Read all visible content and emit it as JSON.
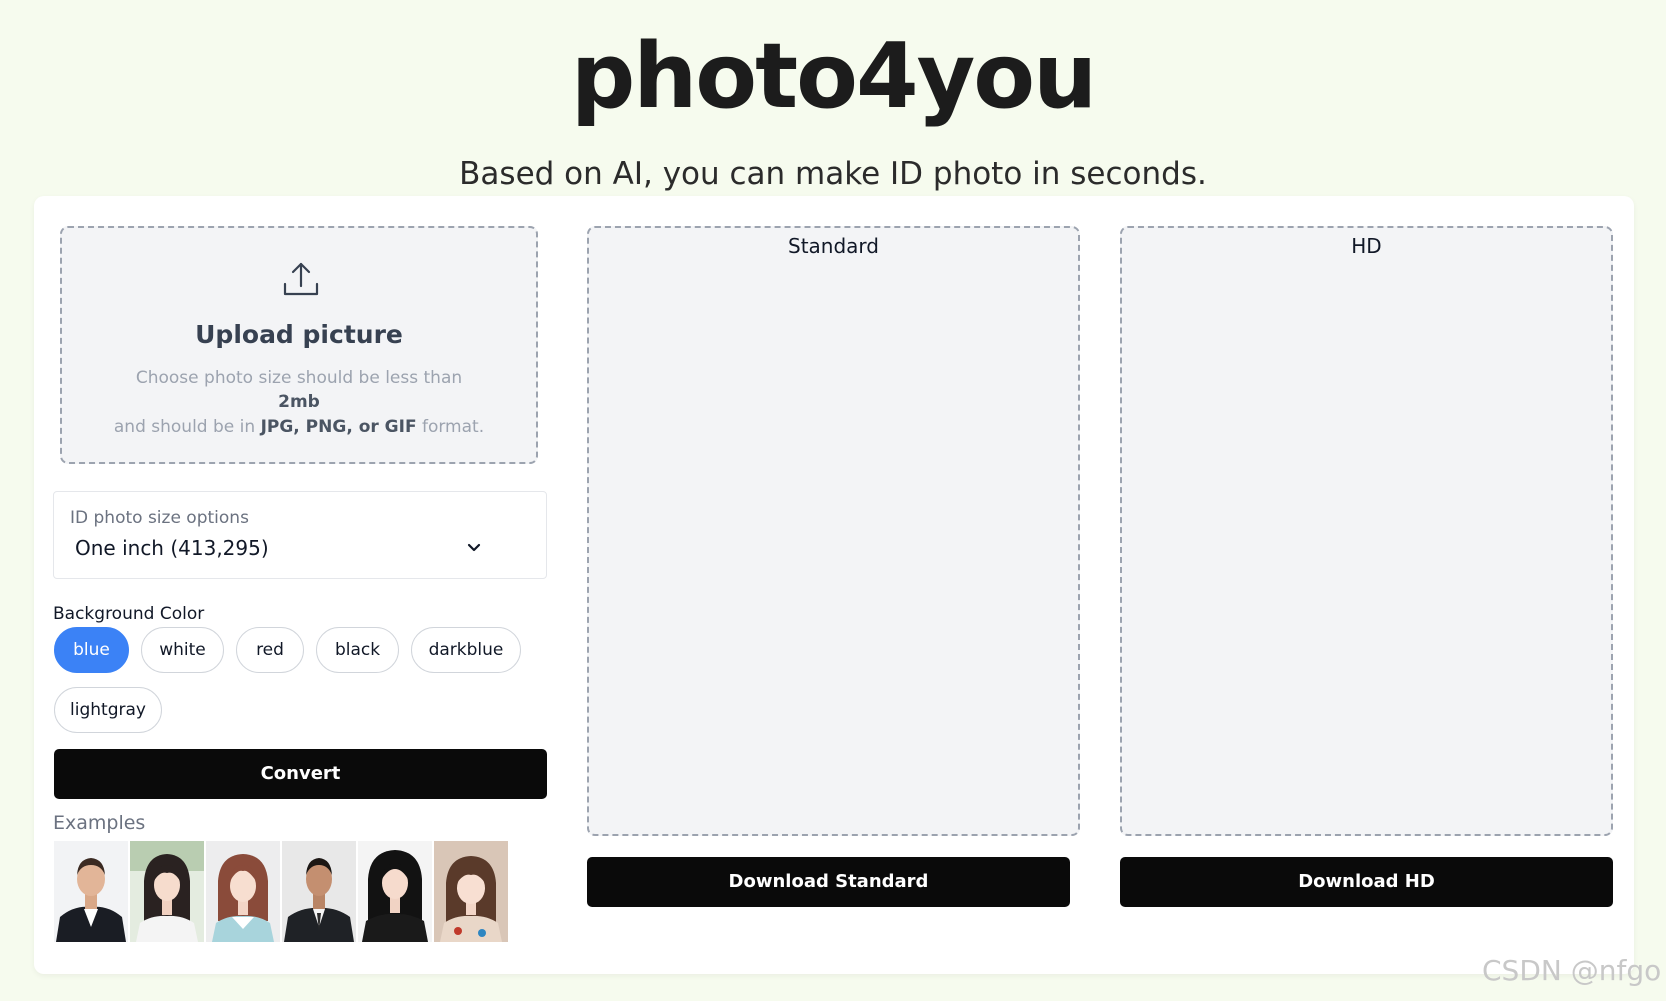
{
  "header": {
    "title": "photo4you",
    "subtitle": "Based on AI, you can make ID photo in seconds."
  },
  "upload": {
    "title": "Upload picture",
    "hint_line1": "Choose photo size should be less than",
    "hint_size": "2mb",
    "hint_line3_prefix": "and should be in",
    "hint_formats": "JPG, PNG, or GIF",
    "hint_line3_suffix": "format."
  },
  "size_select": {
    "label": "ID photo size options",
    "value": "One inch (413,295)"
  },
  "background": {
    "label": "Background Color",
    "options": [
      "blue",
      "white",
      "red",
      "black",
      "darkblue",
      "lightgray"
    ],
    "selected": "blue",
    "accent_color": "#3b82f6"
  },
  "convert_label": "Convert",
  "examples": {
    "label": "Examples",
    "count": 6
  },
  "outputs": {
    "standard_title": "Standard",
    "hd_title": "HD",
    "download_standard_label": "Download Standard",
    "download_hd_label": "Download HD"
  },
  "watermark": "CSDN @nfgo"
}
